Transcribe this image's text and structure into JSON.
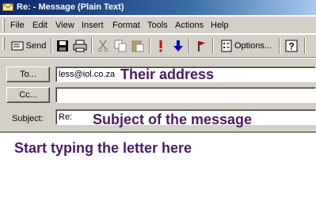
{
  "window": {
    "title": "Re: - Message (Plain Text)"
  },
  "menu": {
    "items": [
      "File",
      "Edit",
      "View",
      "Insert",
      "Format",
      "Tools",
      "Actions",
      "Help"
    ]
  },
  "toolbar": {
    "send_label": "Send",
    "options_label": "Options..."
  },
  "fields": {
    "to_button": "To...",
    "to_value": "less@iol.co.za",
    "cc_button": "Cc...",
    "cc_value": "",
    "subject_label": "Subject:",
    "subject_value": "Re:"
  },
  "annotations": {
    "address": "Their address",
    "subject": "Subject of the message",
    "body": "Start typing the letter here"
  },
  "colors": {
    "annotation": "#4b1a63",
    "titlebar": "#0a246a",
    "chrome": "#d4d0c8"
  }
}
